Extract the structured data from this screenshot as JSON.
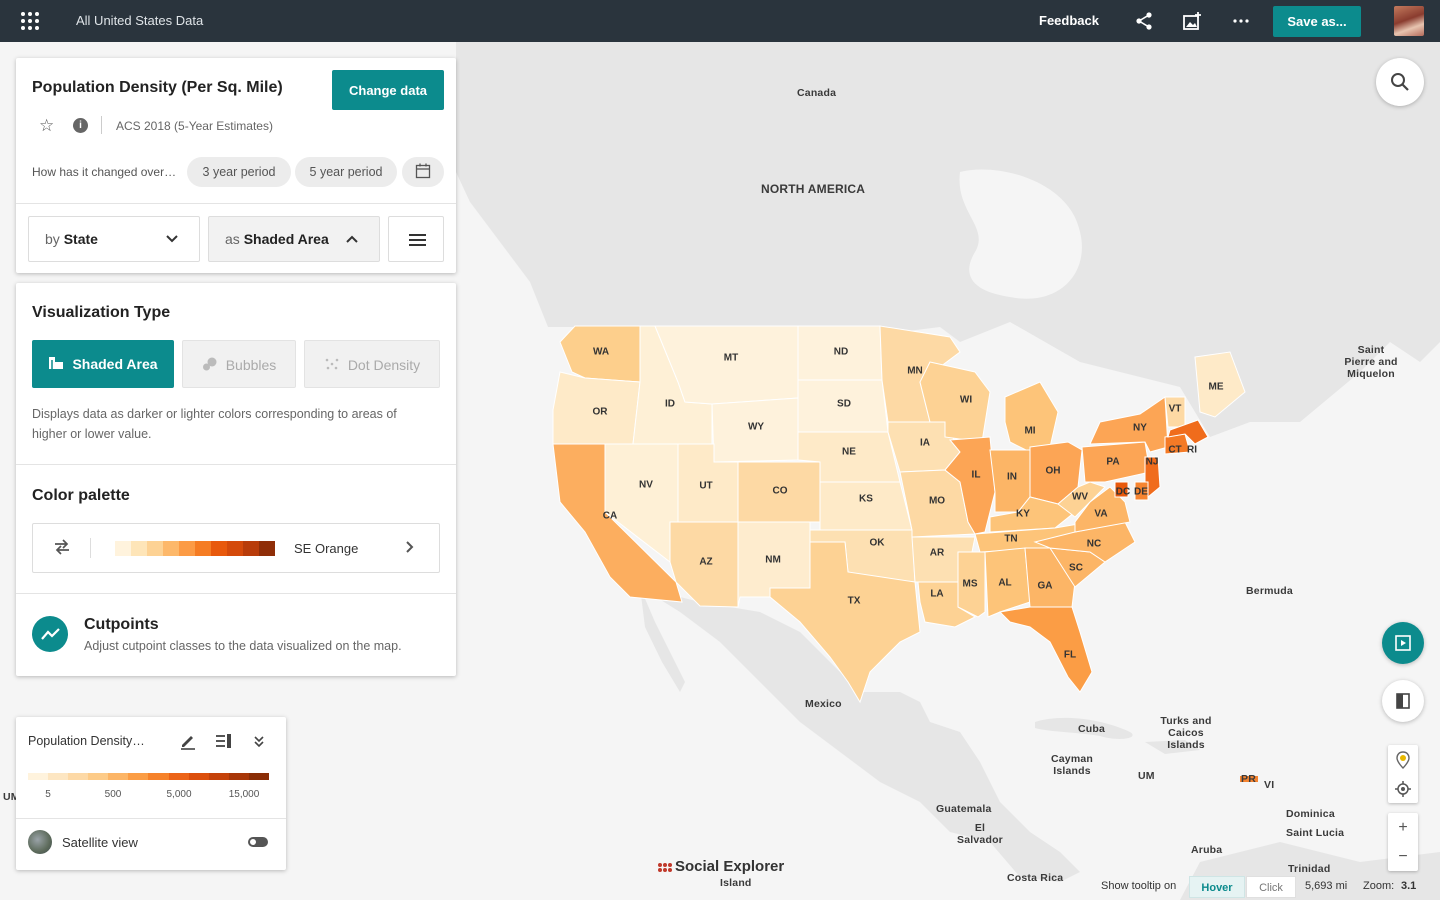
{
  "topbar": {
    "title": "All United States Data",
    "feedback": "Feedback",
    "save_label": "Save as..."
  },
  "data_panel": {
    "title": "Population Density (Per Sq. Mile)",
    "change_data_label": "Change data",
    "survey": "ACS 2018 (5-Year Estimates)",
    "changed_over_prompt": "How has it changed over…",
    "period_3": "3 year period",
    "period_5": "5 year period",
    "by_prefix": "by",
    "by_value": "State",
    "as_prefix": "as",
    "as_value": "Shaded Area"
  },
  "viz_panel": {
    "heading": "Visualization Type",
    "types": [
      "Shaded Area",
      "Bubbles",
      "Dot Density"
    ],
    "active_type": "Shaded Area",
    "description": "Displays data as darker or lighter colors corresponding to areas of higher or lower value.",
    "palette_heading": "Color palette",
    "palette_name": "SE Orange",
    "palette_colors": [
      "#fff3dd",
      "#fee5b8",
      "#fdd294",
      "#fdb86a",
      "#fc9b45",
      "#f57c23",
      "#e8590c",
      "#d44a0b",
      "#b83c0a",
      "#8f2e08"
    ],
    "cutpoints_title": "Cutpoints",
    "cutpoints_desc": "Adjust cutpoint classes to the data visualized on the map."
  },
  "legend": {
    "title": "Population Density…",
    "ticks": [
      "5",
      "500",
      "5,000",
      "15,000"
    ],
    "colors": [
      "#fff3dd",
      "#fde6c2",
      "#fdd9a6",
      "#fdcb88",
      "#fcb566",
      "#fb9d45",
      "#f6822a",
      "#ec6418",
      "#dc4f0c",
      "#c5420a",
      "#a83708",
      "#8a2d06"
    ],
    "satellite_label": "Satellite view",
    "satellite_on": false
  },
  "map": {
    "place_labels": {
      "canada": "Canada",
      "north_america": "NORTH AMERICA",
      "saint_pierre": "Saint Pierre and Miquelon",
      "bermuda": "Bermuda",
      "mexico": "Mexico",
      "cuba": "Cuba",
      "turks": "Turks and Caicos Islands",
      "cayman": "Cayman Islands",
      "um_right": "UM",
      "um_left": "UM",
      "pr": "PR",
      "vi": "VI",
      "guatemala": "Guatemala",
      "el_salvador": "El Salvador",
      "dominica": "Dominica",
      "saint_lucia": "Saint Lucia",
      "aruba": "Aruba",
      "trinidad": "Trinidad",
      "costa_rica": "Costa Rica",
      "island": "Island"
    },
    "states": [
      {
        "abbr": "WA",
        "color": "#fdcf8c"
      },
      {
        "abbr": "OR",
        "color": "#feeac8"
      },
      {
        "abbr": "CA",
        "color": "#fcae5f"
      },
      {
        "abbr": "NV",
        "color": "#fef0d6"
      },
      {
        "abbr": "ID",
        "color": "#fef0d6"
      },
      {
        "abbr": "MT",
        "color": "#fef2dc"
      },
      {
        "abbr": "WY",
        "color": "#fef2dc"
      },
      {
        "abbr": "UT",
        "color": "#feeac8"
      },
      {
        "abbr": "AZ",
        "color": "#fdd9a4"
      },
      {
        "abbr": "NM",
        "color": "#feecce"
      },
      {
        "abbr": "CO",
        "color": "#fdd9a4"
      },
      {
        "abbr": "ND",
        "color": "#fef2dc"
      },
      {
        "abbr": "SD",
        "color": "#fef2dc"
      },
      {
        "abbr": "NE",
        "color": "#feeac8"
      },
      {
        "abbr": "KS",
        "color": "#feeac8"
      },
      {
        "abbr": "OK",
        "color": "#fde0b2"
      },
      {
        "abbr": "TX",
        "color": "#fdd294"
      },
      {
        "abbr": "MN",
        "color": "#fdd9a4"
      },
      {
        "abbr": "IA",
        "color": "#fde0b2"
      },
      {
        "abbr": "MO",
        "color": "#fdd9a4"
      },
      {
        "abbr": "AR",
        "color": "#fde0b2"
      },
      {
        "abbr": "LA",
        "color": "#fdd294"
      },
      {
        "abbr": "WI",
        "color": "#fdd294"
      },
      {
        "abbr": "IL",
        "color": "#fca555"
      },
      {
        "abbr": "MI",
        "color": "#fdc479"
      },
      {
        "abbr": "IN",
        "color": "#fcb566"
      },
      {
        "abbr": "OH",
        "color": "#fca555"
      },
      {
        "abbr": "KY",
        "color": "#fdc479"
      },
      {
        "abbr": "TN",
        "color": "#fdc479"
      },
      {
        "abbr": "MS",
        "color": "#fdd294"
      },
      {
        "abbr": "AL",
        "color": "#fdc479"
      },
      {
        "abbr": "GA",
        "color": "#fcb566"
      },
      {
        "abbr": "FL",
        "color": "#fb9d45"
      },
      {
        "abbr": "SC",
        "color": "#fcb566"
      },
      {
        "abbr": "NC",
        "color": "#fcb566"
      },
      {
        "abbr": "VA",
        "color": "#fcb566"
      },
      {
        "abbr": "WV",
        "color": "#fdd294"
      },
      {
        "abbr": "PA",
        "color": "#fca555"
      },
      {
        "abbr": "NY",
        "color": "#fca555"
      },
      {
        "abbr": "VT",
        "color": "#fdd9a4"
      },
      {
        "abbr": "ME",
        "color": "#feeac8"
      },
      {
        "abbr": "NJ",
        "color": "#f06c1c"
      },
      {
        "abbr": "DC",
        "color": "#e8590c"
      },
      {
        "abbr": "DE",
        "color": "#f68430"
      },
      {
        "abbr": "CT",
        "color": "#f47a26"
      },
      {
        "abbr": "RI",
        "color": "#f06c1c"
      }
    ]
  },
  "statusbar": {
    "tooltip_label": "Show tooltip on",
    "hover": "Hover",
    "click": "Click",
    "scale": "5,693 mi",
    "zoom_label": "Zoom:",
    "zoom_value": "3.1"
  },
  "logo_text": "Social Explorer",
  "colors": {
    "accent": "#0c8b8d",
    "topbar": "#2a343d",
    "land": "#e6e6e6",
    "water": "#f5f5f5"
  }
}
